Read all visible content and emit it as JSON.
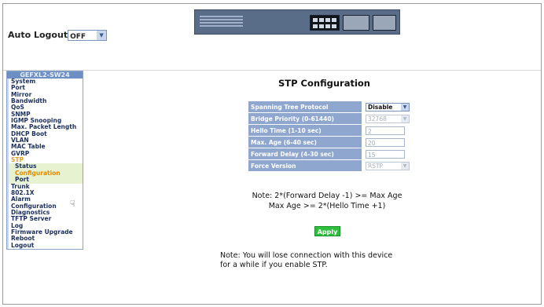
{
  "header": {
    "auto_logout_label": "Auto Logout",
    "auto_logout_value": "OFF"
  },
  "sidebar": {
    "device_name": "GEFXL2-SW24",
    "items": [
      {
        "label": "System"
      },
      {
        "label": "Port"
      },
      {
        "label": "Mirror"
      },
      {
        "label": "Bandwidth"
      },
      {
        "label": "QoS"
      },
      {
        "label": "SNMP"
      },
      {
        "label": "IGMP Snooping"
      },
      {
        "label": "Max. Packet Length"
      },
      {
        "label": "DHCP Boot"
      },
      {
        "label": "VLAN"
      },
      {
        "label": "MAC Table"
      },
      {
        "label": "GVRP"
      },
      {
        "label": "STP"
      },
      {
        "label": "Status"
      },
      {
        "label": "Configuration"
      },
      {
        "label": "Port"
      },
      {
        "label": "Trunk"
      },
      {
        "label": "802.1X"
      },
      {
        "label": "Alarm"
      },
      {
        "label": "Configuration"
      },
      {
        "label": "Diagnostics"
      },
      {
        "label": "TFTP Server"
      },
      {
        "label": "Log"
      },
      {
        "label": "Firmware Upgrade"
      },
      {
        "label": "Reboot"
      },
      {
        "label": "Logout"
      }
    ]
  },
  "main": {
    "title": "STP Configuration",
    "fields": [
      {
        "label": "Spanning Tree Protocol",
        "value": "Disable",
        "type": "select"
      },
      {
        "label": "Bridge Priority (0-61440)",
        "value": "32768",
        "type": "select"
      },
      {
        "label": "Hello Time (1-10 sec)",
        "value": "2",
        "type": "text"
      },
      {
        "label": "Max. Age (6-40 sec)",
        "value": "20",
        "type": "text"
      },
      {
        "label": "Forward Delay (4-30 sec)",
        "value": "15",
        "type": "text"
      },
      {
        "label": "Force Version",
        "value": "RSTP",
        "type": "select"
      }
    ],
    "note_line1": "Note: 2*(Forward Delay -1) >= Max Age",
    "note_line2": "Max Age >= 2*(Hello Time +1)",
    "apply_label": "Apply",
    "warning_line1": "Note: You will lose connection with this device",
    "warning_line2": "for a while if you enable STP."
  },
  "colors": {
    "sidebar_header": "#6d8fc4",
    "label_cell": "#8fa6cf",
    "apply_button": "#2fbf3f",
    "active_item": "#e08a00"
  }
}
